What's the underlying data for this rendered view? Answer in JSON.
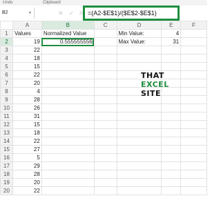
{
  "ribbon": {
    "undo_label": "Undo",
    "clipboard_label": "Clipboard"
  },
  "formula_bar": {
    "cell_ref": "B2",
    "formula": "=(A2-$E$1)/($E$2-$E$1)"
  },
  "sheet": {
    "columns": [
      "A",
      "B",
      "C",
      "D",
      "E",
      "F"
    ],
    "rows": [
      {
        "num": "1",
        "a": "Values",
        "b": "Normalized Value",
        "c": "",
        "d": "Min Value:",
        "e": "4",
        "f": ""
      },
      {
        "num": "2",
        "a": "19",
        "b": "0.555555556",
        "c": "",
        "d": "Max Value:",
        "e": "31",
        "f": ""
      },
      {
        "num": "3",
        "a": "22",
        "b": "",
        "c": "",
        "d": "",
        "e": "",
        "f": ""
      },
      {
        "num": "4",
        "a": "18",
        "b": "",
        "c": "",
        "d": "",
        "e": "",
        "f": ""
      },
      {
        "num": "5",
        "a": "15",
        "b": "",
        "c": "",
        "d": "",
        "e": "",
        "f": ""
      },
      {
        "num": "6",
        "a": "22",
        "b": "",
        "c": "",
        "d": "",
        "e": "",
        "f": ""
      },
      {
        "num": "7",
        "a": "20",
        "b": "",
        "c": "",
        "d": "",
        "e": "",
        "f": ""
      },
      {
        "num": "8",
        "a": "4",
        "b": "",
        "c": "",
        "d": "",
        "e": "",
        "f": ""
      },
      {
        "num": "9",
        "a": "28",
        "b": "",
        "c": "",
        "d": "",
        "e": "",
        "f": ""
      },
      {
        "num": "10",
        "a": "26",
        "b": "",
        "c": "",
        "d": "",
        "e": "",
        "f": ""
      },
      {
        "num": "11",
        "a": "31",
        "b": "",
        "c": "",
        "d": "",
        "e": "",
        "f": ""
      },
      {
        "num": "12",
        "a": "15",
        "b": "",
        "c": "",
        "d": "",
        "e": "",
        "f": ""
      },
      {
        "num": "13",
        "a": "18",
        "b": "",
        "c": "",
        "d": "",
        "e": "",
        "f": ""
      },
      {
        "num": "14",
        "a": "22",
        "b": "",
        "c": "",
        "d": "",
        "e": "",
        "f": ""
      },
      {
        "num": "15",
        "a": "27",
        "b": "",
        "c": "",
        "d": "",
        "e": "",
        "f": ""
      },
      {
        "num": "16",
        "a": "5",
        "b": "",
        "c": "",
        "d": "",
        "e": "",
        "f": ""
      },
      {
        "num": "17",
        "a": "29",
        "b": "",
        "c": "",
        "d": "",
        "e": "",
        "f": ""
      },
      {
        "num": "18",
        "a": "28",
        "b": "",
        "c": "",
        "d": "",
        "e": "",
        "f": ""
      },
      {
        "num": "19",
        "a": "20",
        "b": "",
        "c": "",
        "d": "",
        "e": "",
        "f": ""
      },
      {
        "num": "20",
        "a": "22",
        "b": "",
        "c": "",
        "d": "",
        "e": "",
        "f": ""
      }
    ]
  },
  "logo": {
    "line1": "THAT",
    "line2": "EXCEL",
    "line3": "SITE"
  },
  "colors": {
    "accent": "#1e8e3e",
    "header_bg": "#f2f2f2",
    "gridline": "#e2e2e2"
  },
  "icons": [
    "close-icon",
    "check-icon",
    "fx-icon",
    "chevron-down-icon"
  ]
}
